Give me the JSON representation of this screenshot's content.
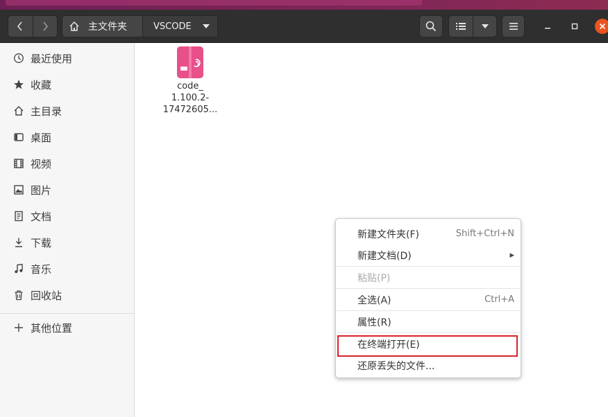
{
  "window": {
    "path_home_label": "主文件夹",
    "path_current_label": "VSCODE"
  },
  "icons": {
    "back": "chevron-left-icon",
    "forward": "chevron-right-icon",
    "home": "home-icon",
    "search": "search-icon",
    "list_view": "list-view-icon",
    "view_menu": "chevron-down-icon",
    "hamburger": "hamburger-menu-icon",
    "minimize": "minimize-icon",
    "maximize": "maximize-icon",
    "close": "close-icon"
  },
  "colors": {
    "titlebar": "#2f2f2f",
    "accent_close": "#e95420",
    "package_icon": "#e8508a",
    "highlight_box": "#d9232b"
  },
  "sidebar": {
    "items": [
      {
        "label": "最近使用",
        "icon": "clock-icon"
      },
      {
        "label": "收藏",
        "icon": "star-icon"
      },
      {
        "label": "主目录",
        "icon": "home-icon"
      },
      {
        "label": "桌面",
        "icon": "desktop-icon"
      },
      {
        "label": "视频",
        "icon": "video-icon"
      },
      {
        "label": "图片",
        "icon": "image-icon"
      },
      {
        "label": "文档",
        "icon": "document-icon"
      },
      {
        "label": "下载",
        "icon": "download-icon"
      },
      {
        "label": "音乐",
        "icon": "music-icon"
      },
      {
        "label": "回收站",
        "icon": "trash-icon"
      }
    ],
    "other_locations": {
      "label": "其他位置",
      "icon": "plus-icon"
    }
  },
  "files": [
    {
      "name_lines": [
        "code_",
        "1.100.2-",
        "17472605..."
      ],
      "icon": "deb-package-icon"
    }
  ],
  "context_menu": {
    "items": [
      {
        "label": "新建文件夹(F)",
        "accel": "Shift+Ctrl+N"
      },
      {
        "label": "新建文档(D)",
        "accel": "▸"
      },
      {
        "label": "粘贴(P)",
        "accel": ""
      },
      {
        "label": "全选(A)",
        "accel": "Ctrl+A"
      },
      {
        "label": "属性(R)",
        "accel": ""
      },
      {
        "label": "在终端打开(E)",
        "accel": ""
      },
      {
        "label": "还原丢失的文件...",
        "accel": ""
      }
    ]
  }
}
